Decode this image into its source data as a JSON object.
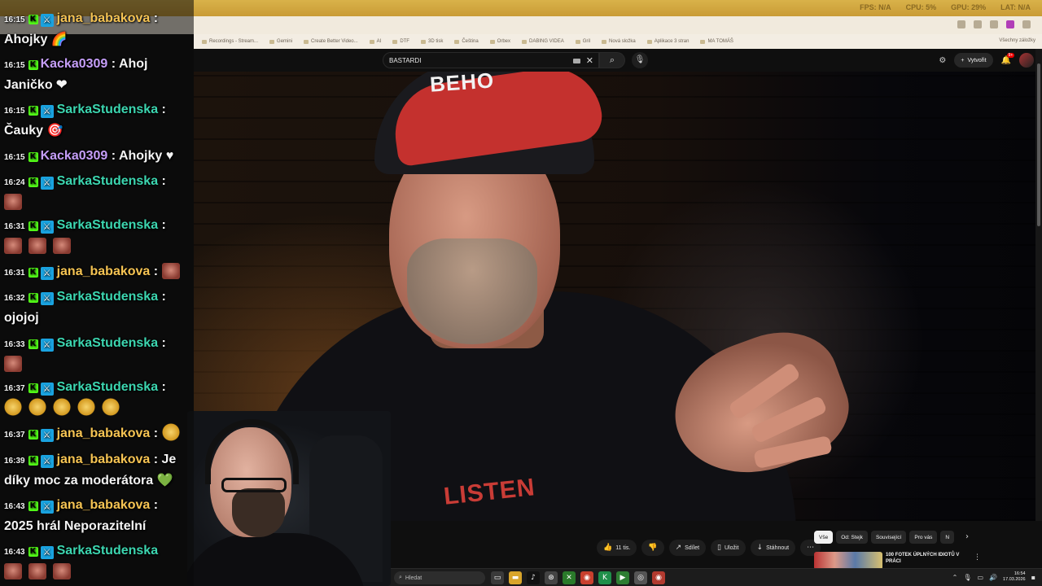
{
  "browser": {
    "bookmarks": [
      "Recordings - Stream...",
      "Gemini",
      "Create Better Video...",
      "AI",
      "DTF",
      "3D tisk",
      "Čeština",
      "Orbex",
      "DABING VIDEA",
      "Gril",
      "Nová složka",
      "Aplikace 3 stran",
      "MA TOMÁŠ"
    ],
    "all_bookmarks": "Všechny záložky",
    "sys_stats": [
      "FPS: N/A",
      "CPU: 5%",
      "GPU: 29%",
      "LAT: N/A"
    ]
  },
  "youtube": {
    "search_query": "BASTARDI",
    "create_label": "Vytvořit",
    "notifications_count": "9+",
    "like_count": "11 tis.",
    "share_label": "Sdílet",
    "save_label": "Uložit",
    "download_label": "Stáhnout",
    "chips": [
      "Vše",
      "Od: Stejk",
      "Související",
      "Pro vás",
      "N"
    ],
    "recommended_title": "100 FOTEK ÚPLNÝCH IDIOTŮ V PRÁCI",
    "video": {
      "cap_text": "BEHO",
      "shirt_text": "LISTEN"
    }
  },
  "taskbar": {
    "search_placeholder": "Hledat",
    "time": "16:54",
    "date": "17.03.2026"
  },
  "chat": {
    "messages": [
      {
        "time": "16:15",
        "user": "jana_babakova",
        "text": "Ahojky 🌈",
        "color": "yellow",
        "mod": true
      },
      {
        "time": "16:15",
        "user": "Kacka0309",
        "text": "Ahoj Janičko ❤",
        "color": "purple",
        "mod": false
      },
      {
        "time": "16:15",
        "user": "SarkaStudenska",
        "text": "Čauky 🎯",
        "color": "teal",
        "mod": true
      },
      {
        "time": "16:15",
        "user": "Kacka0309",
        "text": "Ahojky ♥",
        "color": "purple",
        "mod": false
      },
      {
        "time": "16:24",
        "user": "SarkaStudenska",
        "text": "",
        "color": "teal",
        "mod": true,
        "emotes": 1
      },
      {
        "time": "16:31",
        "user": "SarkaStudenska",
        "text": "",
        "color": "teal",
        "mod": true,
        "emotes": 3
      },
      {
        "time": "16:31",
        "user": "jana_babakova",
        "text": "",
        "color": "yellow",
        "mod": true,
        "emotes": 1
      },
      {
        "time": "16:32",
        "user": "SarkaStudenska",
        "text": "ojojoj",
        "color": "teal",
        "mod": true
      },
      {
        "time": "16:33",
        "user": "SarkaStudenska",
        "text": "",
        "color": "teal",
        "mod": true,
        "emotes": 1
      },
      {
        "time": "16:37",
        "user": "SarkaStudenska",
        "text": "",
        "color": "teal",
        "mod": true,
        "emotes": 5
      },
      {
        "time": "16:37",
        "user": "jana_babakova",
        "text": "",
        "color": "yellow",
        "mod": true,
        "emotes": 1
      },
      {
        "time": "16:39",
        "user": "jana_babakova",
        "text": "Je díky moc za moderátora 💚",
        "color": "yellow",
        "mod": true
      },
      {
        "time": "16:43",
        "user": "jana_babakova",
        "text": "2025 hrál Neporazitelní",
        "color": "yellow",
        "mod": true
      },
      {
        "time": "16:43",
        "user": "SarkaStudenska",
        "text": "",
        "color": "teal",
        "mod": true,
        "emotes": 3
      }
    ]
  },
  "colors": {
    "kick_green": "#53fc18",
    "mod_blue": "#1aa3e0",
    "user_yellow": "#f6c453",
    "user_purple": "#c59ef8",
    "user_teal": "#3cd6b0"
  }
}
